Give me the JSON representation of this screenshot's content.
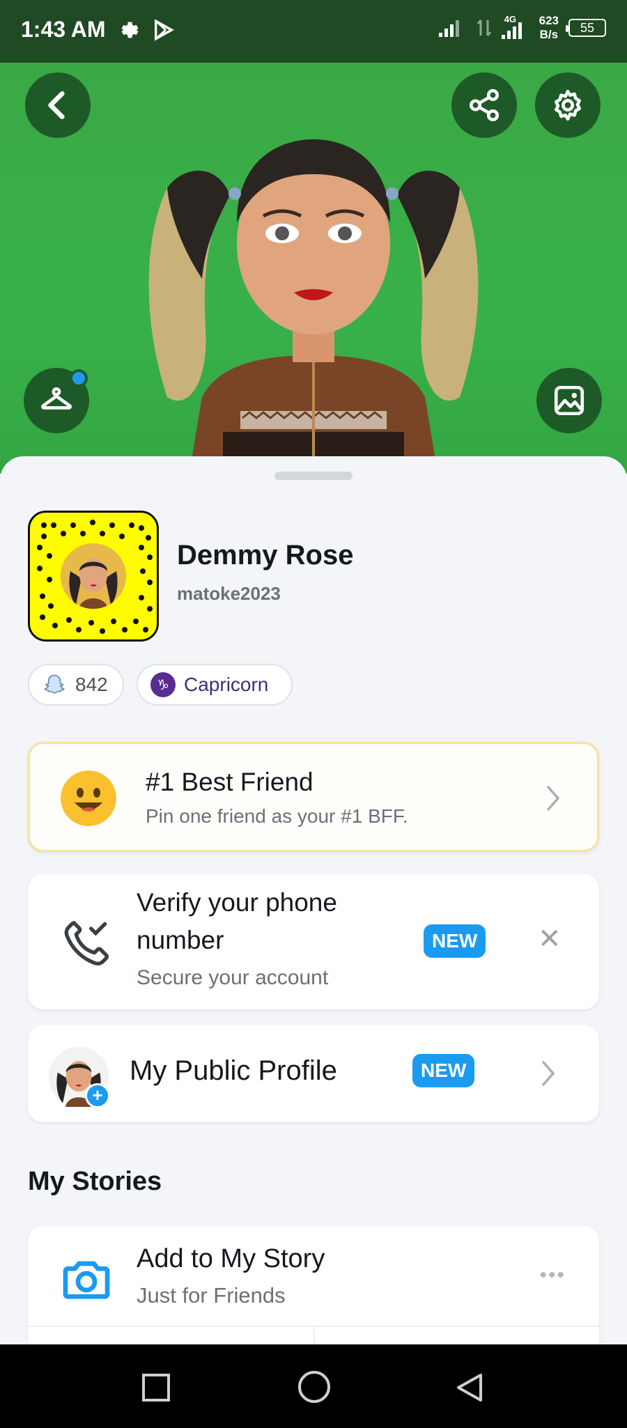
{
  "status_bar": {
    "time": "1:43 AM",
    "network_type": "4G",
    "net_speed_value": "623",
    "net_speed_unit": "B/s",
    "battery": "55",
    "icons": [
      "settings-icon",
      "play-store-icon",
      "signal-icon",
      "data-arrows-icon",
      "signal-icon-2"
    ]
  },
  "header": {
    "back_icon": "chevron-left-icon",
    "share_icon": "share-icon",
    "settings_icon": "gear-icon",
    "wardrobe_icon": "hanger-icon",
    "background_icon": "image-icon",
    "background_color": "#39b14a"
  },
  "profile": {
    "display_name": "Demmy Rose",
    "username": "matoke2023",
    "snap_score": "842",
    "zodiac": "Capricorn",
    "zodiac_symbol": "♑"
  },
  "cards": {
    "bff": {
      "title": "#1 Best Friend",
      "subtitle": "Pin one friend as your #1 BFF."
    },
    "verify": {
      "title_line1": "Verify your phone",
      "title_line2": "number",
      "subtitle": "Secure your account",
      "badge": "NEW",
      "close": "✕"
    },
    "public_profile": {
      "title": "My Public Profile",
      "badge": "NEW"
    }
  },
  "stories": {
    "section_title": "My Stories",
    "add_title": "Add to My Story",
    "add_subtitle": "Just for Friends",
    "more": "•••"
  },
  "colors": {
    "accent_blue": "#1a9bf0",
    "snapcode_yellow": "#fffc00",
    "header_green": "#39b14a",
    "status_green": "#1f4a23"
  }
}
